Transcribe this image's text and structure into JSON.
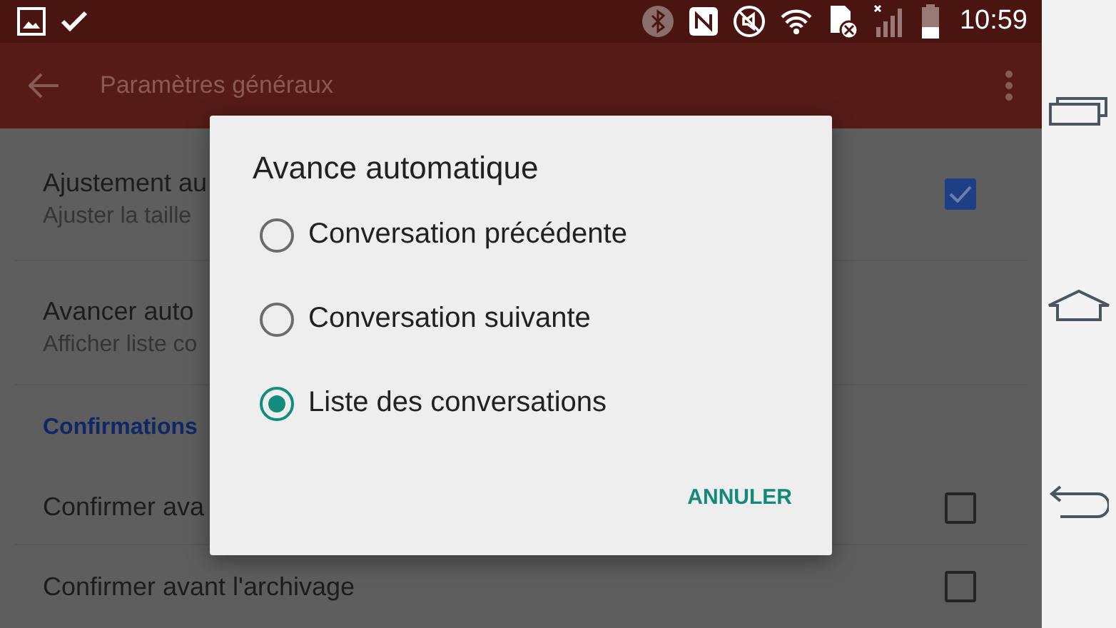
{
  "status_bar": {
    "time": "10:59"
  },
  "app_bar": {
    "title": "Paramètres généraux"
  },
  "settings": [
    {
      "kind": "checkbox",
      "title": "Ajustement au",
      "subtitle": "Ajuster la taille",
      "checked": true
    },
    {
      "kind": "plain",
      "title": "Avancer auto",
      "subtitle": "Afficher liste co"
    },
    {
      "kind": "header",
      "title": "Confirmations"
    },
    {
      "kind": "checkbox",
      "title": "Confirmer ava",
      "checked": false
    },
    {
      "kind": "checkbox",
      "title": "Confirmer avant l'archivage",
      "checked": false
    }
  ],
  "dialog": {
    "title": "Avance automatique",
    "options": [
      {
        "label": "Conversation précédente",
        "selected": false
      },
      {
        "label": "Conversation suivante",
        "selected": false
      },
      {
        "label": "Liste des conversations",
        "selected": true
      }
    ],
    "button": "ANNULER"
  }
}
